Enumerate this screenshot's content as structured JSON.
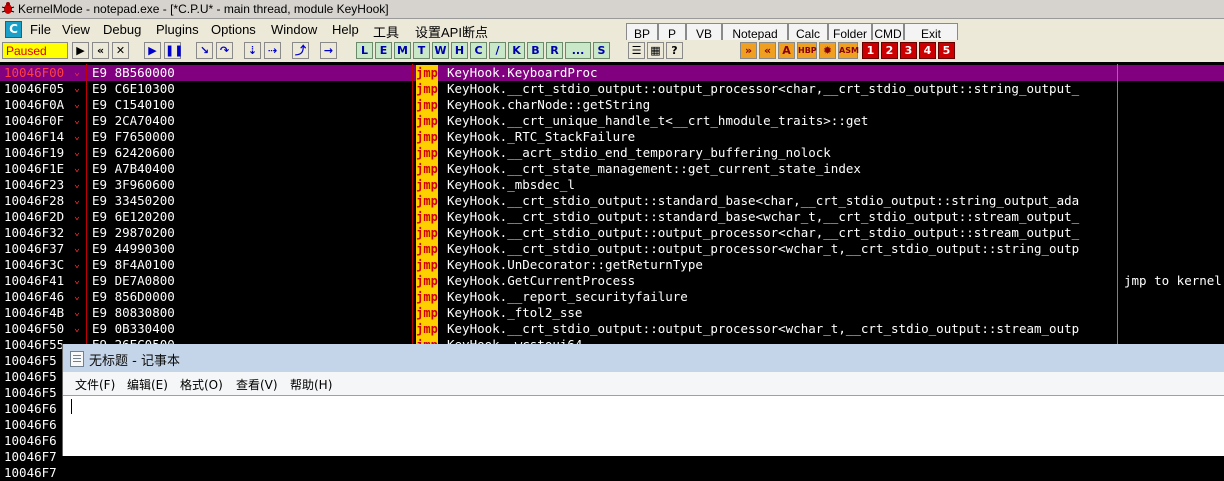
{
  "window": {
    "title": "KernelMode - notepad.exe - [*C.P.U* - main thread, module KeyHook]"
  },
  "menu": {
    "c_icon": "C",
    "items": [
      "File",
      "View",
      "Debug",
      "Plugins",
      "Options",
      "Window",
      "Help",
      "工具",
      "设置API断点"
    ]
  },
  "ext_toolbar": {
    "buttons": [
      "BP",
      "P",
      "VB",
      "Notepad",
      "Calc",
      "Folder",
      "CMD",
      "Exit"
    ]
  },
  "toolbar": {
    "status": "Paused",
    "letters": [
      "L",
      "E",
      "M",
      "T",
      "W",
      "H",
      "C",
      "/",
      "K",
      "B",
      "R",
      "...",
      "S"
    ],
    "numbered": [
      "1",
      "2",
      "3",
      "4",
      "5"
    ]
  },
  "disasm": {
    "rows": [
      {
        "addr": "10046F00",
        "hex": "E9 8B560000",
        "op": "jmp",
        "instr": "KeyHook.KeyboardProc",
        "comment": ""
      },
      {
        "addr": "10046F05",
        "hex": "E9 C6E10300",
        "op": "jmp",
        "instr": "KeyHook.__crt_stdio_output::output_processor<char,__crt_stdio_output::string_output_",
        "comment": ""
      },
      {
        "addr": "10046F0A",
        "hex": "E9 C1540100",
        "op": "jmp",
        "instr": "KeyHook.charNode::getString",
        "comment": ""
      },
      {
        "addr": "10046F0F",
        "hex": "E9 2CA70400",
        "op": "jmp",
        "instr": "KeyHook.__crt_unique_handle_t<__crt_hmodule_traits>::get",
        "comment": ""
      },
      {
        "addr": "10046F14",
        "hex": "E9 F7650000",
        "op": "jmp",
        "instr": "KeyHook._RTC_StackFailure",
        "comment": ""
      },
      {
        "addr": "10046F19",
        "hex": "E9 62420600",
        "op": "jmp",
        "instr": "KeyHook.__acrt_stdio_end_temporary_buffering_nolock",
        "comment": ""
      },
      {
        "addr": "10046F1E",
        "hex": "E9 A7B40400",
        "op": "jmp",
        "instr": "KeyHook.__crt_state_management::get_current_state_index",
        "comment": ""
      },
      {
        "addr": "10046F23",
        "hex": "E9 3F960600",
        "op": "jmp",
        "instr": "KeyHook._mbsdec_l",
        "comment": ""
      },
      {
        "addr": "10046F28",
        "hex": "E9 33450200",
        "op": "jmp",
        "instr": "KeyHook.__crt_stdio_output::standard_base<char,__crt_stdio_output::string_output_ada",
        "comment": ""
      },
      {
        "addr": "10046F2D",
        "hex": "E9 6E120200",
        "op": "jmp",
        "instr": "KeyHook.__crt_stdio_output::standard_base<wchar_t,__crt_stdio_output::stream_output_",
        "comment": ""
      },
      {
        "addr": "10046F32",
        "hex": "E9 29870200",
        "op": "jmp",
        "instr": "KeyHook.__crt_stdio_output::output_processor<char,__crt_stdio_output::stream_output_",
        "comment": ""
      },
      {
        "addr": "10046F37",
        "hex": "E9 44990300",
        "op": "jmp",
        "instr": "KeyHook.__crt_stdio_output::output_processor<wchar_t,__crt_stdio_output::string_outp",
        "comment": ""
      },
      {
        "addr": "10046F3C",
        "hex": "E9 8F4A0100",
        "op": "jmp",
        "instr": "KeyHook.UnDecorator::getReturnType",
        "comment": ""
      },
      {
        "addr": "10046F41",
        "hex": "E9 DE7A0800",
        "op": "jmp",
        "instr": "KeyHook.GetCurrentProcess",
        "comment": "jmp to kernel"
      },
      {
        "addr": "10046F46",
        "hex": "E9 856D0000",
        "op": "jmp",
        "instr": "KeyHook.__report_securityfailure",
        "comment": ""
      },
      {
        "addr": "10046F4B",
        "hex": "E9 80830800",
        "op": "jmp",
        "instr": "KeyHook._ftol2_sse",
        "comment": ""
      },
      {
        "addr": "10046F50",
        "hex": "E9 0B330400",
        "op": "jmp",
        "instr": "KeyHook.__crt_stdio_output::output_processor<wchar_t,__crt_stdio_output::stream_outp",
        "comment": ""
      },
      {
        "addr": "10046F55",
        "hex": "E9 26EC0500",
        "op": "jmp",
        "instr": "KeyHook._wcstoui64",
        "comment": ""
      }
    ],
    "left_partial": [
      "10046F5",
      "10046F5",
      "10046F5",
      "10046F6",
      "10046F6",
      "10046F6",
      "10046F7",
      "10046F7"
    ]
  },
  "notepad": {
    "title": "无标题 - 记事本",
    "menu": [
      "文件(F)",
      "编辑(E)",
      "格式(O)",
      "查看(V)",
      "帮助(H)"
    ]
  },
  "colors": {
    "selected_row": "#800080",
    "jmp_badge": "#ffd000",
    "status_bg": "#ffff00"
  }
}
